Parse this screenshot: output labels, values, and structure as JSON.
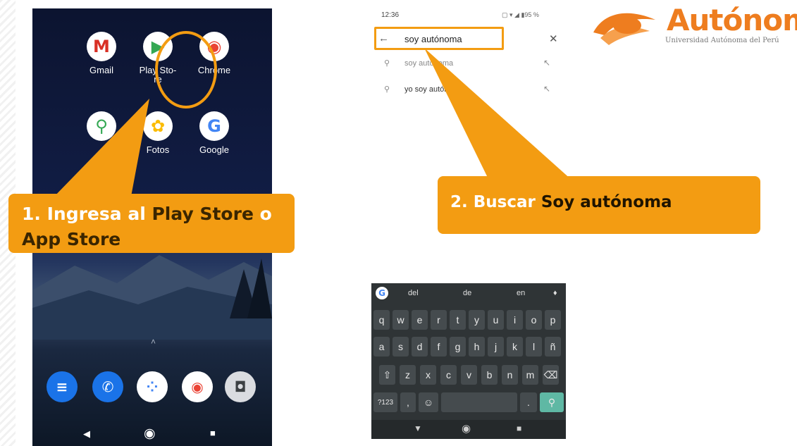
{
  "home_screen": {
    "apps_row1": [
      {
        "label": "Gmail",
        "icon": "gmail-icon",
        "glyph": "M",
        "color": "#d93025"
      },
      {
        "label": "Play Sto-\nre",
        "icon": "play-store-icon",
        "glyph": "▶",
        "color": "#34a853"
      },
      {
        "label": "Chrome",
        "icon": "chrome-icon",
        "glyph": "◉",
        "color": "#ea4335"
      }
    ],
    "apps_row2": [
      {
        "label": "",
        "icon": "maps-icon",
        "glyph": "⚲",
        "color": "#34a853"
      },
      {
        "label": "Fotos",
        "icon": "photos-icon",
        "glyph": "✿",
        "color": "#fbbc05"
      },
      {
        "label": "Google",
        "icon": "google-icon",
        "glyph": "G",
        "color": "#4285f4"
      }
    ],
    "dock": [
      {
        "icon": "messages-icon",
        "glyph": "≡",
        "color": "#1a73e8"
      },
      {
        "icon": "phone-icon",
        "glyph": "✆",
        "color": "#1a73e8"
      },
      {
        "icon": "assistant-icon",
        "glyph": "⁘",
        "color": "#ffffff"
      },
      {
        "icon": "chrome-dock-icon",
        "glyph": "◉",
        "color": "#ea4335"
      },
      {
        "icon": "camera-icon",
        "glyph": "◘",
        "color": "#5f6368"
      }
    ],
    "nav": {
      "back": "◀",
      "home": "◉",
      "recents": "■"
    }
  },
  "callout1": {
    "part1": "1. Ingresa al ",
    "part2": "Play Store",
    "part3": " o",
    "line2": "App Store"
  },
  "search_screen": {
    "time": "12:36",
    "status_icons": "▢ ▾ ◢ ▮95 %",
    "query": "soy autónoma",
    "suggestions": [
      {
        "text": "soy autónoma"
      },
      {
        "text": "yo soy autónoma"
      }
    ]
  },
  "callout2": {
    "part1": "2. Buscar ",
    "part2": "Soy autónoma"
  },
  "logo": {
    "title": "Autónoma",
    "subtitle": "Universidad Autónoma del Perú",
    "accent": "#ee7d1f"
  },
  "keyboard": {
    "suggestions": [
      "del",
      "de",
      "en"
    ],
    "row1": [
      "q",
      "w",
      "e",
      "r",
      "t",
      "y",
      "u",
      "i",
      "o",
      "p"
    ],
    "row2": [
      "a",
      "s",
      "d",
      "f",
      "g",
      "h",
      "j",
      "k",
      "l",
      "ñ"
    ],
    "row3": [
      "⇧",
      "z",
      "x",
      "c",
      "v",
      "b",
      "n",
      "m",
      "⌫"
    ],
    "row4_left": "?123",
    "bottom": {
      "back": "▼",
      "home": "◉",
      "recents": "■"
    }
  },
  "colors": {
    "accent": "#f39c12"
  }
}
